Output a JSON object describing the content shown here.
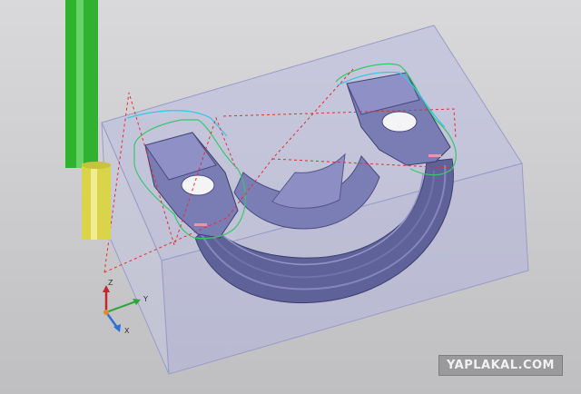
{
  "scene": {
    "description_free": true,
    "colors": {
      "background": "#cfcfd1",
      "stock_fill": "#b5b7de",
      "stock_edge": "#9597c4",
      "part_fill": "#6c6ea8",
      "part_dark": "#4d4f86",
      "part_light": "#8a8cc0",
      "tool_shaft": "#2fb22f",
      "tool_holder": "#d9d44a",
      "toolpath_green": "#36c86a",
      "toolpath_cyan": "#38c6e6",
      "rapid_red": "#e03030"
    }
  },
  "triad": {
    "z_label": "Z",
    "y_label": "Y",
    "x_label": "X",
    "z_color": "#c0282b",
    "y_color": "#2da53a",
    "x_color": "#2f6fd8"
  },
  "watermark": {
    "text": "YAPLAKAL.COM"
  }
}
